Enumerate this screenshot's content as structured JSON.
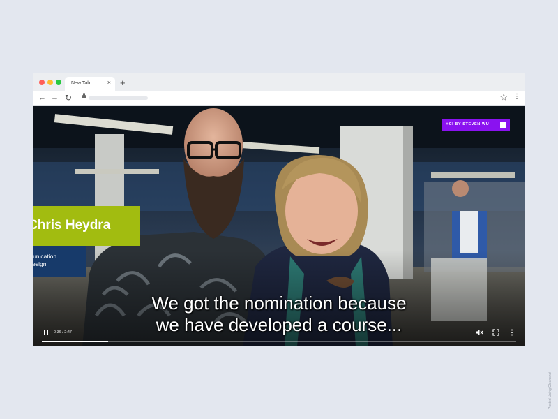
{
  "browser": {
    "tab_title": "New Tab",
    "tab_close": "×",
    "new_tab": "+",
    "back": "←",
    "forward": "→",
    "reload": "↻",
    "star": "☆",
    "menu": "⋮",
    "colors": {
      "close": "#ff5f57",
      "minimize": "#febc2e",
      "maximize": "#28c840"
    }
  },
  "video": {
    "brand_badge": "HCI by Steven Wu",
    "brand_color": "#8a12f0",
    "lower_third": {
      "name": "Chris Heydra",
      "role": "munication\nDesign",
      "name_color": "#a2bc10",
      "role_color": "#173a6a"
    },
    "subtitles": [
      "We got the nomination because",
      "we have developed a course..."
    ],
    "player": {
      "time": "0:36 / 2:47",
      "progress": 0.139,
      "icons": [
        "pause-icon",
        "mute-icon",
        "fullscreen-icon",
        "more-options-icon"
      ]
    }
  },
  "watermark": "Posted Using Cleanshot"
}
